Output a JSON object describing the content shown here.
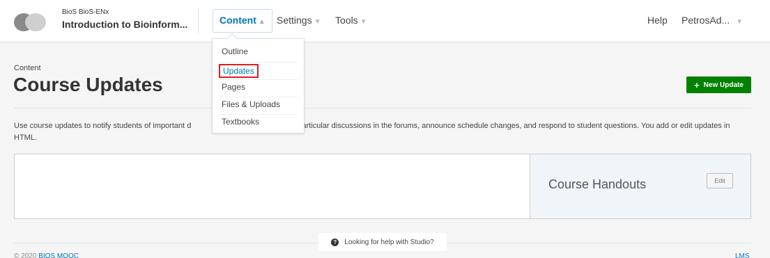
{
  "header": {
    "course_org": "BioS BioS-ENx",
    "course_title": "Introduction to Bioinform...",
    "nav": {
      "content": "Content",
      "settings": "Settings",
      "tools": "Tools",
      "help": "Help",
      "user": "PetrosAd..."
    },
    "caret_up": "▲",
    "caret_down": "▼"
  },
  "dropdown": {
    "items": [
      "Outline",
      "Updates",
      "Pages",
      "Files & Uploads",
      "Textbooks"
    ],
    "highlight_color": "#e01a22"
  },
  "page": {
    "section_label": "Content",
    "title": "Course Updates",
    "new_update_label": "New Update",
    "plus_glyph": "+",
    "intro_visible_start": "Use course updates to notify students of important d",
    "intro_visible_end": "particular discussions in the forums, announce schedule changes, and respond to student questions. You add or edit updates in HTML."
  },
  "handouts": {
    "title": "Course Handouts",
    "edit_label": "Edit"
  },
  "footer": {
    "help_text": "Looking for help with Studio?",
    "help_icon": "question-circle-icon",
    "copyright_prefix": "© 2020",
    "org_link": "BIOS MOOC",
    "right_link": "LMS"
  },
  "colors": {
    "link_blue": "#0075b4",
    "button_green": "#008100",
    "background": "#f5f5f5"
  }
}
